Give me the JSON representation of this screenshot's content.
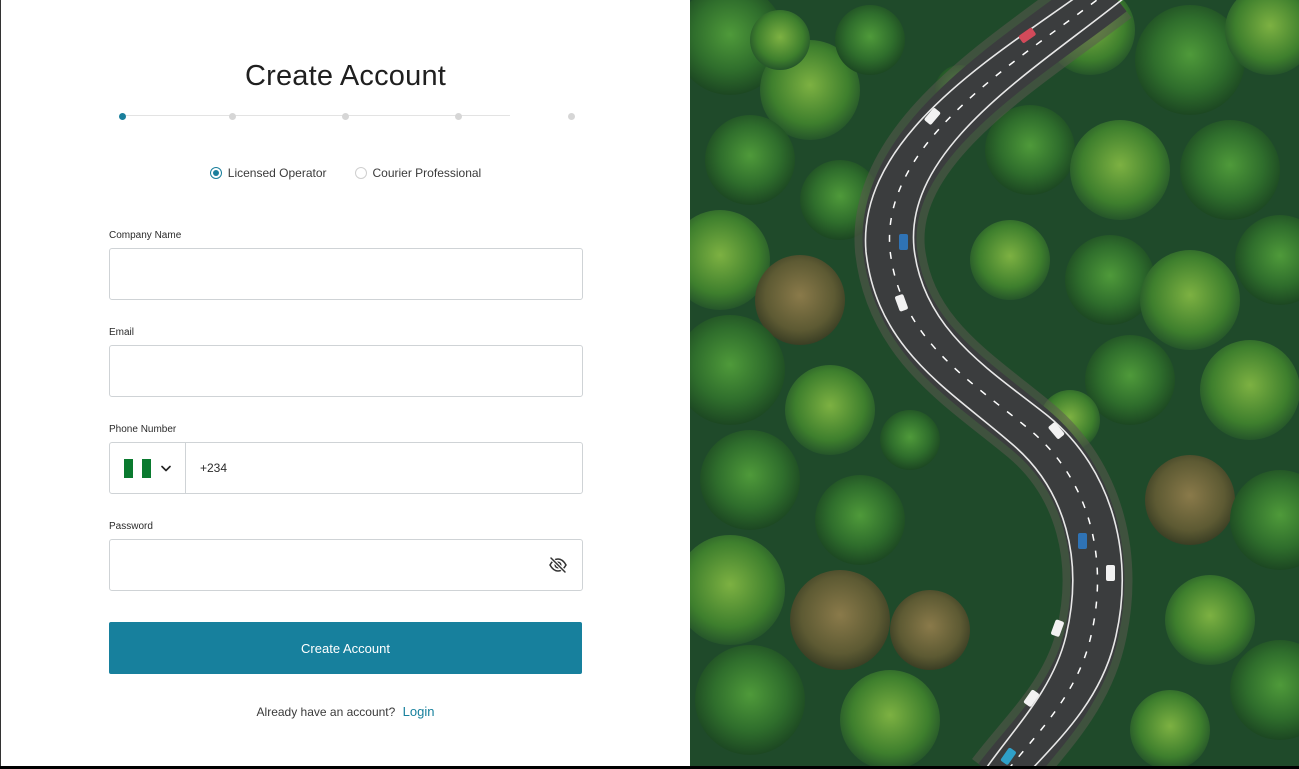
{
  "title": "Create Account",
  "stepper": {
    "steps": 5,
    "active": 1
  },
  "account_types": [
    {
      "label": "Licensed Operator",
      "checked": true
    },
    {
      "label": "Courier Professional",
      "checked": false
    }
  ],
  "fields": {
    "company_name": {
      "label": "Company Name",
      "value": ""
    },
    "email": {
      "label": "Email",
      "value": ""
    },
    "phone": {
      "label": "Phone Number",
      "country_flag": "nigeria-flag-icon",
      "value": "+234"
    },
    "password": {
      "label": "Password",
      "value": ""
    }
  },
  "submit_label": "Create Account",
  "footer": {
    "prompt": "Already have an account?",
    "link": "Login"
  },
  "colors": {
    "accent": "#17809d",
    "flag_green": "#0a7a2f",
    "flag_white": "#ffffff"
  },
  "hero_image": {
    "description_icon": "aerial-forest-road-image"
  }
}
